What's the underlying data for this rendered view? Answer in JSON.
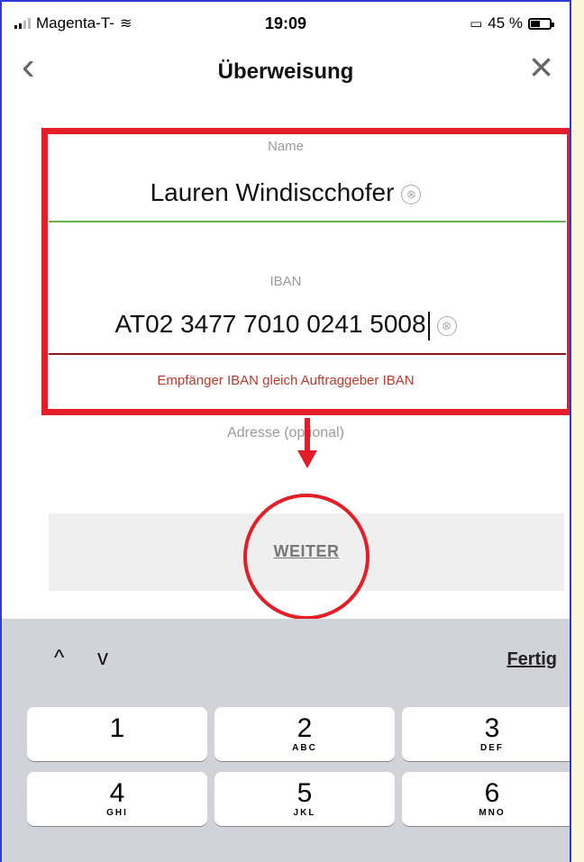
{
  "status_bar": {
    "carrier": "Magenta-T-",
    "time": "19:09",
    "battery": "45 %",
    "battery_fraction": 0.45
  },
  "nav": {
    "back_icon": "‹",
    "title": "Überweisung",
    "close_icon": "×"
  },
  "form": {
    "name_label": "Name",
    "name_value": "Lauren Windiscchofer",
    "iban_label": "IBAN",
    "iban_value": "AT02 3477 7010 0241 5008",
    "error_text": "Empfänger IBAN gleich Auftraggeber IBAN",
    "address_label": "Adresse (optional)",
    "clear_icon": "⊗"
  },
  "actions": {
    "weiter_label": "WEITER"
  },
  "keyboard": {
    "up_icon": "^",
    "down_icon": "v",
    "done_label": "Fertig",
    "keys": [
      {
        "num": "1",
        "letters": ""
      },
      {
        "num": "2",
        "letters": "ABC"
      },
      {
        "num": "3",
        "letters": "DEF"
      },
      {
        "num": "4",
        "letters": "GHI"
      },
      {
        "num": "5",
        "letters": "JKL"
      },
      {
        "num": "6",
        "letters": "MNO"
      }
    ]
  },
  "colors": {
    "annotation_red": "#e41e26",
    "valid_line": "#6ab04c",
    "error_text": "#c0392b",
    "frame_border": "#2f3bd6"
  }
}
